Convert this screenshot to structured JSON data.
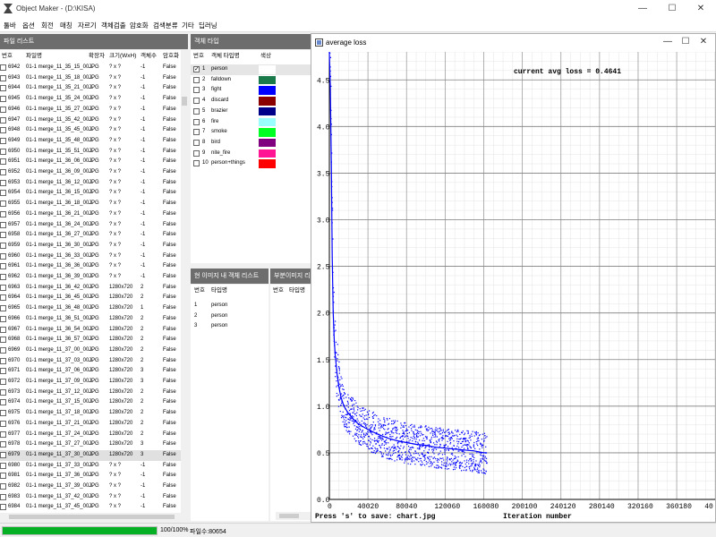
{
  "app": {
    "title": "Object Maker - (D:\\KISA)"
  },
  "window_controls": [
    "—",
    "☐",
    "✕"
  ],
  "menu": [
    "툴바",
    "옵션",
    "회전",
    "매칭",
    "자르기",
    "객체검출",
    "암호화",
    "검색분류",
    "기타",
    "딥러닝"
  ],
  "file_list": {
    "title": "파일 리스트",
    "columns": [
      "번호",
      "파일명",
      "확장자",
      "크기(WxH)",
      "객체수",
      "암호화"
    ],
    "rows": [
      [
        "6942",
        "01-1 merge_11_35_15_00...",
        "JPG",
        "? x ?",
        "-1",
        "False"
      ],
      [
        "6943",
        "01-1 merge_11_35_18_00...",
        "JPG",
        "? x ?",
        "-1",
        "False"
      ],
      [
        "6944",
        "01-1 merge_11_35_21_00...",
        "JPG",
        "? x ?",
        "-1",
        "False"
      ],
      [
        "6945",
        "01-1 merge_11_35_24_00...",
        "JPG",
        "? x ?",
        "-1",
        "False"
      ],
      [
        "6946",
        "01-1 merge_11_35_27_00...",
        "JPG",
        "? x ?",
        "-1",
        "False"
      ],
      [
        "6947",
        "01-1 merge_11_35_42_00...",
        "JPG",
        "? x ?",
        "-1",
        "False"
      ],
      [
        "6948",
        "01-1 merge_11_35_45_00...",
        "JPG",
        "? x ?",
        "-1",
        "False"
      ],
      [
        "6949",
        "01-1 merge_11_35_48_00...",
        "JPG",
        "? x ?",
        "-1",
        "False"
      ],
      [
        "6950",
        "01-1 merge_11_35_51_00...",
        "JPG",
        "? x ?",
        "-1",
        "False"
      ],
      [
        "6951",
        "01-1 merge_11_36_06_00...",
        "JPG",
        "? x ?",
        "-1",
        "False"
      ],
      [
        "6952",
        "01-1 merge_11_36_09_00...",
        "JPG",
        "? x ?",
        "-1",
        "False"
      ],
      [
        "6953",
        "01-1 merge_11_36_12_00...",
        "JPG",
        "? x ?",
        "-1",
        "False"
      ],
      [
        "6954",
        "01-1 merge_11_36_15_00...",
        "JPG",
        "? x ?",
        "-1",
        "False"
      ],
      [
        "6955",
        "01-1 merge_11_36_18_00...",
        "JPG",
        "? x ?",
        "-1",
        "False"
      ],
      [
        "6956",
        "01-1 merge_11_36_21_00...",
        "JPG",
        "? x ?",
        "-1",
        "False"
      ],
      [
        "6957",
        "01-1 merge_11_36_24_00...",
        "JPG",
        "? x ?",
        "-1",
        "False"
      ],
      [
        "6958",
        "01-1 merge_11_36_27_00...",
        "JPG",
        "? x ?",
        "-1",
        "False"
      ],
      [
        "6959",
        "01-1 merge_11_36_30_00...",
        "JPG",
        "? x ?",
        "-1",
        "False"
      ],
      [
        "6960",
        "01-1 merge_11_36_33_00...",
        "JPG",
        "? x ?",
        "-1",
        "False"
      ],
      [
        "6961",
        "01-1 merge_11_36_36_00...",
        "JPG",
        "? x ?",
        "-1",
        "False"
      ],
      [
        "6962",
        "01-1 merge_11_36_39_00...",
        "JPG",
        "? x ?",
        "-1",
        "False"
      ],
      [
        "6963",
        "01-1 merge_11_36_42_00...",
        "JPG",
        "1280x720",
        "2",
        "False"
      ],
      [
        "6964",
        "01-1 merge_11_36_45_00...",
        "JPG",
        "1280x720",
        "2",
        "False"
      ],
      [
        "6965",
        "01-1 merge_11_36_48_00...",
        "JPG",
        "1280x720",
        "1",
        "False"
      ],
      [
        "6966",
        "01-1 merge_11_36_51_00...",
        "JPG",
        "1280x720",
        "2",
        "False"
      ],
      [
        "6967",
        "01-1 merge_11_36_54_00...",
        "JPG",
        "1280x720",
        "2",
        "False"
      ],
      [
        "6968",
        "01-1 merge_11_36_57_00...",
        "JPG",
        "1280x720",
        "2",
        "False"
      ],
      [
        "6969",
        "01-1 merge_11_37_00_00...",
        "JPG",
        "1280x720",
        "2",
        "False"
      ],
      [
        "6970",
        "01-1 merge_11_37_03_00...",
        "JPG",
        "1280x720",
        "2",
        "False"
      ],
      [
        "6971",
        "01-1 merge_11_37_06_00...",
        "JPG",
        "1280x720",
        "3",
        "False"
      ],
      [
        "6972",
        "01-1 merge_11_37_09_00...",
        "JPG",
        "1280x720",
        "3",
        "False"
      ],
      [
        "6973",
        "01-1 merge_11_37_12_00...",
        "JPG",
        "1280x720",
        "2",
        "False"
      ],
      [
        "6974",
        "01-1 merge_11_37_15_00...",
        "JPG",
        "1280x720",
        "2",
        "False"
      ],
      [
        "6975",
        "01-1 merge_11_37_18_00...",
        "JPG",
        "1280x720",
        "2",
        "False"
      ],
      [
        "6976",
        "01-1 merge_11_37_21_00...",
        "JPG",
        "1280x720",
        "2",
        "False"
      ],
      [
        "6977",
        "01-1 merge_11_37_24_00...",
        "JPG",
        "1280x720",
        "2",
        "False"
      ],
      [
        "6978",
        "01-1 merge_11_37_27_00...",
        "JPG",
        "1280x720",
        "3",
        "False"
      ],
      [
        "6979",
        "01-1 merge_11_37_30_00...",
        "JPG",
        "1280x720",
        "3",
        "False"
      ],
      [
        "6980",
        "01-1 merge_11_37_33_00...",
        "JPG",
        "? x ?",
        "-1",
        "False"
      ],
      [
        "6981",
        "01-1 merge_11_37_36_00...",
        "JPG",
        "? x ?",
        "-1",
        "False"
      ],
      [
        "6982",
        "01-1 merge_11_37_39_00...",
        "JPG",
        "? x ?",
        "-1",
        "False"
      ],
      [
        "6983",
        "01-1 merge_11_37_42_00...",
        "JPG",
        "? x ?",
        "-1",
        "False"
      ],
      [
        "6984",
        "01-1 merge_11_37_45_00...",
        "JPG",
        "? x ?",
        "-1",
        "False"
      ]
    ],
    "selected_number": "6979"
  },
  "object_types": {
    "title": "객체 타입",
    "columns": [
      "번호",
      "객체 타입명",
      "색상"
    ],
    "rows": [
      {
        "no": "1",
        "name": "person",
        "color": "#ffffff",
        "checked": true
      },
      {
        "no": "2",
        "name": "falldown",
        "color": "#1a7a4a"
      },
      {
        "no": "3",
        "name": "fight",
        "color": "#0000ff"
      },
      {
        "no": "4",
        "name": "discard",
        "color": "#8b0000"
      },
      {
        "no": "5",
        "name": "brazier",
        "color": "#00008b"
      },
      {
        "no": "6",
        "name": "fire",
        "color": "#99ffff"
      },
      {
        "no": "7",
        "name": "smoke",
        "color": "#00ff22"
      },
      {
        "no": "8",
        "name": "bird",
        "color": "#800080"
      },
      {
        "no": "9",
        "name": "nite_fire",
        "color": "#ff1493"
      },
      {
        "no": "10",
        "name": "person+things",
        "color": "#ff0000"
      }
    ]
  },
  "image_objects": {
    "title": "현 이미지 내 객체 리스트",
    "columns": [
      "번호",
      "타입명"
    ],
    "rows": [
      [
        "1",
        "person"
      ],
      [
        "2",
        "person"
      ],
      [
        "3",
        "person"
      ]
    ]
  },
  "sub_images": {
    "title": "부분이미지 리스트",
    "columns": [
      "번호",
      "타입명"
    ]
  },
  "status": {
    "progress_percent": 100,
    "progress_text": "100/100%",
    "file_count": "파일수:80654"
  },
  "chart_window": {
    "title": "average loss"
  },
  "chart_data": {
    "type": "scatter",
    "annotation": "current avg loss = 0.4641",
    "footer_left": "Press 's' to save: chart.jpg",
    "xlabel": "Iteration number",
    "xlim": [
      0,
      400000
    ],
    "ylim": [
      0,
      4.8
    ],
    "x_ticks": [
      "0",
      "40020",
      "80040",
      "120060",
      "160080",
      "200100",
      "240120",
      "280140",
      "320160",
      "360180",
      "40"
    ],
    "y_ticks": [
      "0.0",
      "0.5",
      "1.0",
      "1.5",
      "2.0",
      "2.5",
      "3.0",
      "3.5",
      "4.0",
      "4.5"
    ],
    "grid": true,
    "color": "#0000ff",
    "x_end": 163000,
    "points": [
      [
        0,
        4.8
      ],
      [
        1000,
        4.4
      ],
      [
        2000,
        3.6
      ],
      [
        3000,
        2.6
      ],
      [
        4000,
        2.0
      ],
      [
        5000,
        1.72
      ],
      [
        6000,
        1.55
      ],
      [
        8000,
        1.35
      ],
      [
        10000,
        1.2
      ],
      [
        12000,
        1.1
      ],
      [
        15000,
        1.0
      ],
      [
        20000,
        0.92
      ],
      [
        25000,
        0.86
      ],
      [
        30000,
        0.81
      ],
      [
        40000,
        0.75
      ],
      [
        50000,
        0.7
      ],
      [
        60000,
        0.66
      ],
      [
        70000,
        0.63
      ],
      [
        80000,
        0.61
      ],
      [
        90000,
        0.59
      ],
      [
        100000,
        0.58
      ],
      [
        110000,
        0.56
      ],
      [
        120000,
        0.55
      ],
      [
        130000,
        0.54
      ],
      [
        140000,
        0.53
      ],
      [
        150000,
        0.52
      ],
      [
        160000,
        0.5
      ],
      [
        163000,
        0.5
      ]
    ]
  }
}
